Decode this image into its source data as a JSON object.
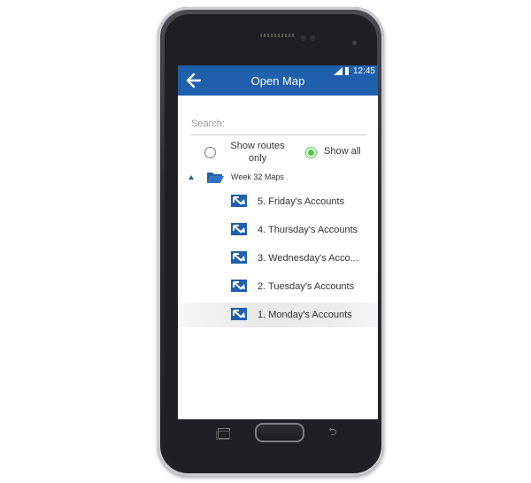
{
  "appbar": {
    "title": "Open Map"
  },
  "statusbar": {
    "time": "12:45"
  },
  "search": {
    "placeholder": "Search:"
  },
  "filter": {
    "options": [
      {
        "label": "Show routes only",
        "selected": false
      },
      {
        "label": "Show all",
        "selected": true
      }
    ]
  },
  "tree": {
    "folder": {
      "label": "Week 32 Maps",
      "expanded": true
    },
    "items": [
      {
        "label": "5. Friday's Accounts",
        "selected": false
      },
      {
        "label": "4. Thursday's Accounts",
        "selected": false
      },
      {
        "label": "3. Wednesday's Acco...",
        "selected": false
      },
      {
        "label": "2. Tuesday's Accounts",
        "selected": false
      },
      {
        "label": "1. Monday's Accounts",
        "selected": true
      }
    ]
  },
  "colors": {
    "primary": "#1f5fac",
    "radio_on": "#4cc93f",
    "phone": "#2b2d31"
  }
}
